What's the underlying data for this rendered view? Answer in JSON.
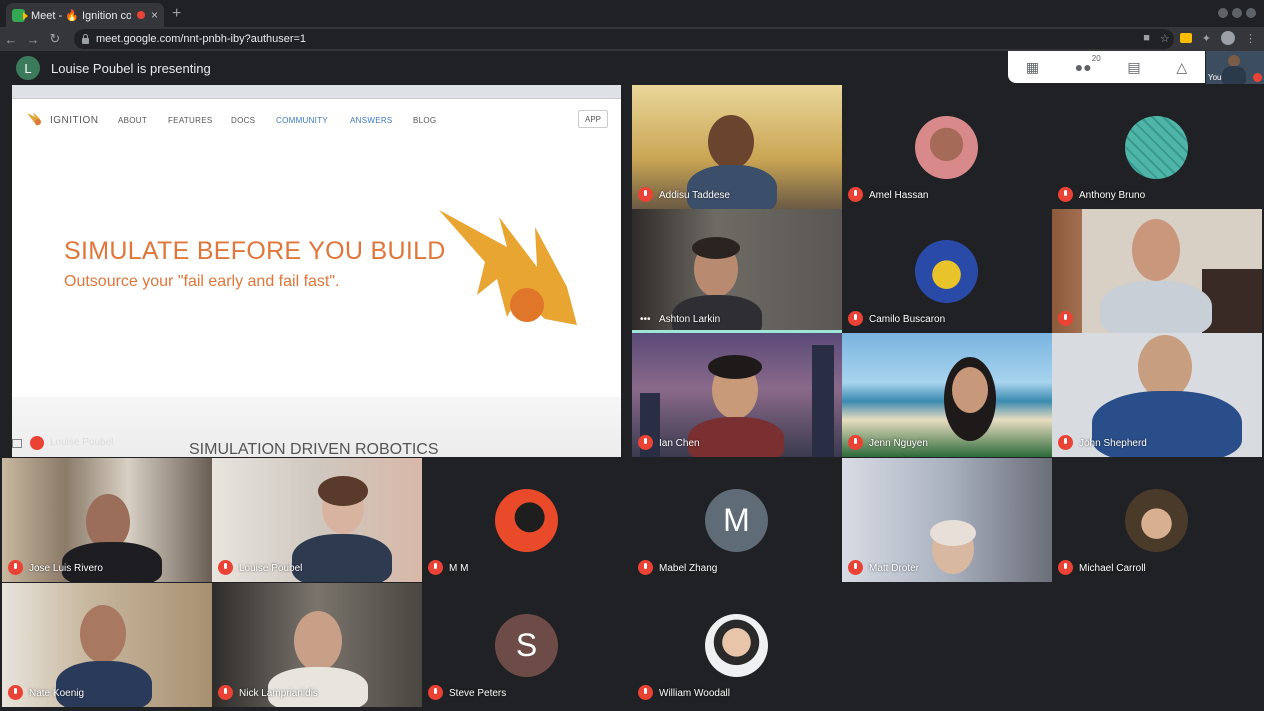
{
  "browser": {
    "tab_title": "Meet - 🔥 Ignition com",
    "tab_close": "×",
    "new_tab": "+",
    "url": "meet.google.com/nnt-pnbh-iby?authuser=1"
  },
  "meet": {
    "presenting_initial": "L",
    "presenting_text": "Louise Poubel is presenting",
    "people_count": "20",
    "self_label": "You"
  },
  "presentation": {
    "site_name": "IGNITION",
    "nav": [
      "ABOUT",
      "FEATURES",
      "DOCS",
      "COMMUNITY",
      "ANSWERS",
      "BLOG"
    ],
    "app_button": "APP",
    "hero_title": "SIMULATE BEFORE YOU BUILD",
    "hero_subtitle": "Outsource your \"fail early and fail fast\".",
    "section_title": "SIMULATION DRIVEN ROBOTICS",
    "presenter_name": "Louise Poubel"
  },
  "participants": [
    {
      "name": "Addisu Taddese"
    },
    {
      "name": "Amel Hassan"
    },
    {
      "name": "Anthony Bruno"
    },
    {
      "name": "Ashton Larkin"
    },
    {
      "name": "Camilo Buscaron"
    },
    {
      "name": "Ian Chen"
    },
    {
      "name": "Jenn Nguyen"
    },
    {
      "name": "John Shepherd"
    },
    {
      "name": "Jose Luis Rivero"
    },
    {
      "name": "Louise Poubel"
    },
    {
      "name": "M M"
    },
    {
      "name": "Mabel Zhang",
      "initial": "M"
    },
    {
      "name": "Matt Droter"
    },
    {
      "name": "Michael Carroll"
    },
    {
      "name": "Nate Koenig"
    },
    {
      "name": "Nick Lamprianidis"
    },
    {
      "name": "Steve Peters",
      "initial": "S"
    },
    {
      "name": "William Woodall"
    }
  ],
  "colors": {
    "meet_bg": "#202124",
    "muted_red": "#ea4335",
    "brand_orange": "#e0763a",
    "speaking_outline": "#9ee5d8"
  }
}
